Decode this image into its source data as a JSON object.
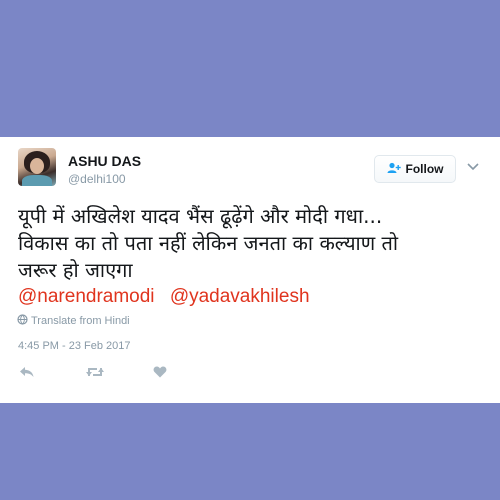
{
  "user": {
    "name": "ASHU DAS",
    "handle": "@delhi100"
  },
  "follow_button": {
    "label": "Follow",
    "icon": "add-user-icon"
  },
  "menu_icon": "chevron-down-icon",
  "tweet": {
    "text": "यूपी में अखिलेश यादव भैंस ढूढ़ेंगे और मोदी गधा...\nविकास का तो पता नहीं लेकिन जनता का कल्याण तो\nजरूर हो जाएगा",
    "mentions": [
      "@narendramodi",
      "@yadavakhilesh"
    ],
    "translate_label": "Translate from Hindi",
    "timestamp": "4:45 PM - 23 Feb 2017"
  },
  "actions": [
    "reply-icon",
    "retweet-icon",
    "like-icon"
  ],
  "colors": {
    "background": "#7b86c6",
    "card": "#ffffff",
    "mention": "#e0341e",
    "muted": "#8899a6",
    "text": "#14171a"
  }
}
